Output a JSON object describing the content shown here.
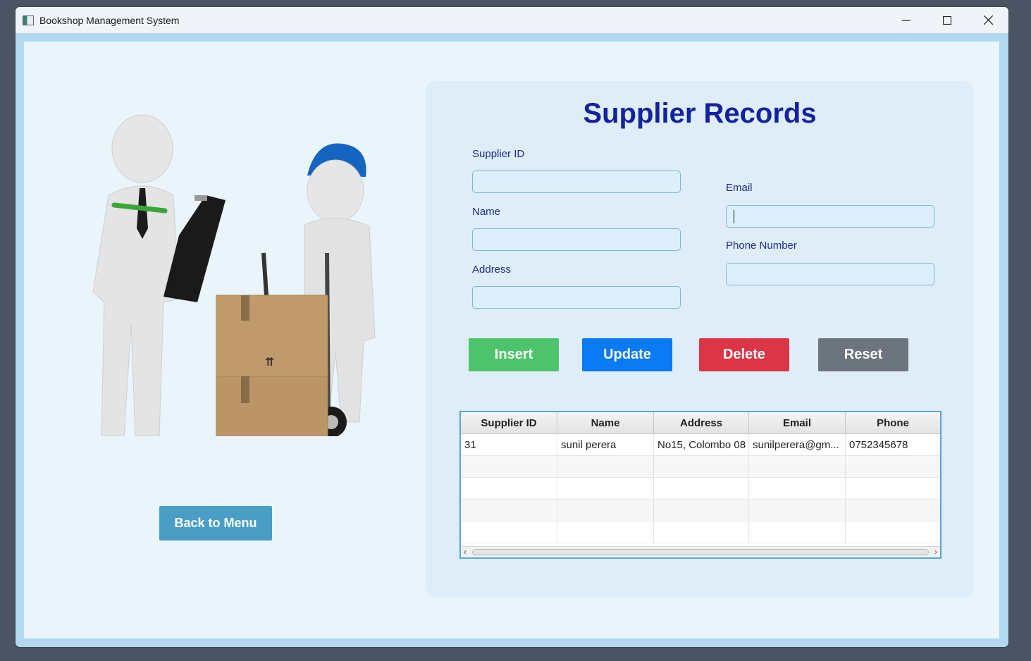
{
  "window": {
    "title": "Bookshop Management System",
    "controls": {
      "minimize": "—",
      "maximize": "☐",
      "close": "✕"
    }
  },
  "left": {
    "illustration_icon": "delivery-workers-with-boxes-illustration",
    "back_button": "Back to Menu"
  },
  "panel": {
    "title": "Supplier Records",
    "fields": {
      "supplier_id": {
        "label": "Supplier ID",
        "value": ""
      },
      "name": {
        "label": "Name",
        "value": ""
      },
      "address": {
        "label": "Address",
        "value": ""
      },
      "email": {
        "label": "Email",
        "value": ""
      },
      "phone": {
        "label": "Phone Number",
        "value": ""
      }
    },
    "buttons": {
      "insert": "Insert",
      "update": "Update",
      "delete": "Delete",
      "reset": "Reset"
    }
  },
  "table": {
    "columns": [
      "Supplier ID",
      "Name",
      "Address",
      "Email",
      "Phone"
    ],
    "rows": [
      [
        "31",
        "sunil perera",
        "No15, Colombo 08",
        "sunilperera@gm...",
        "0752345678"
      ]
    ]
  },
  "colors": {
    "insert": "#4dc46b",
    "update": "#0a7af5",
    "delete": "#dc3545",
    "reset": "#6c757d",
    "back": "#4a9ec6",
    "title": "#14239c"
  }
}
